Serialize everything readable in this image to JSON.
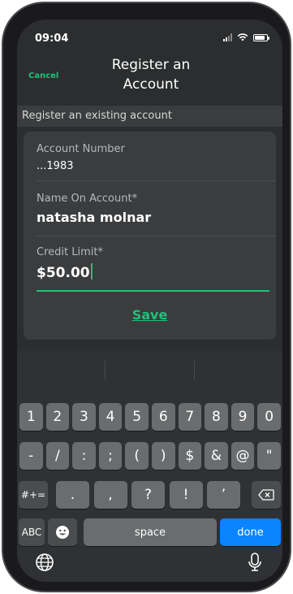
{
  "status_bar": {
    "time": "09:04"
  },
  "nav": {
    "cancel_label": "Cancel",
    "title": "Register an Account"
  },
  "section_header": "Register an existing account",
  "form": {
    "account_number": {
      "label": "Account Number",
      "value": "...1983"
    },
    "name_on_account": {
      "label": "Name On Account*",
      "value": "natasha molnar"
    },
    "credit_limit": {
      "label": "Credit Limit*",
      "value": "$50.00"
    },
    "save_label": "Save"
  },
  "keyboard": {
    "row1": [
      "1",
      "2",
      "3",
      "4",
      "5",
      "6",
      "7",
      "8",
      "9",
      "0"
    ],
    "row2": [
      "-",
      "/",
      ":",
      ";",
      "(",
      ")",
      "$",
      "&",
      "@",
      "\""
    ],
    "row3_left": "#+=",
    "row3": [
      ".",
      ",",
      "?",
      "!",
      "’"
    ],
    "abc_label": "ABC",
    "space_label": "space",
    "done_label": "done"
  },
  "colors": {
    "accent": "#22c07a",
    "done_key": "#0a84ff"
  }
}
